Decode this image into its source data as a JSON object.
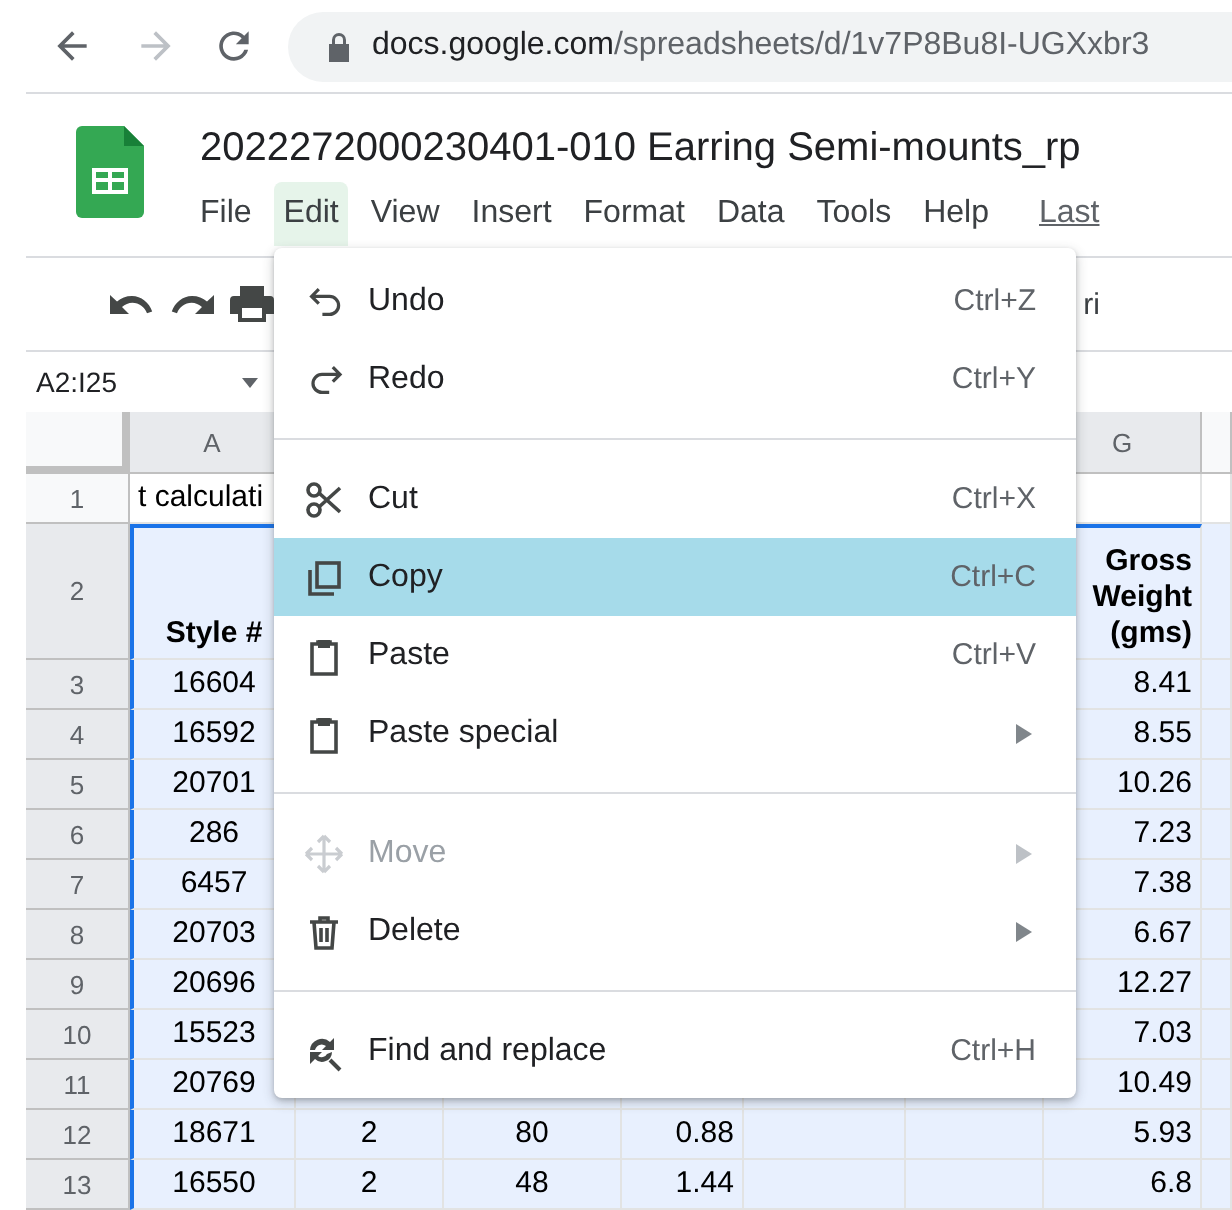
{
  "browser": {
    "url_host": "docs.google.com",
    "url_path": "/spreadsheets/d/1v7P8Bu8I-UGXxbr3"
  },
  "document": {
    "title": "2022272000230401-010 Earring Semi-mounts_rp"
  },
  "menubar": [
    {
      "label": "File",
      "selected": false
    },
    {
      "label": "Edit",
      "selected": true
    },
    {
      "label": "View",
      "selected": false
    },
    {
      "label": "Insert",
      "selected": false
    },
    {
      "label": "Format",
      "selected": false
    },
    {
      "label": "Data",
      "selected": false
    },
    {
      "label": "Tools",
      "selected": false
    },
    {
      "label": "Help",
      "selected": false
    }
  ],
  "last_edit_link": "Last",
  "toolbar": {
    "font_text": "ri"
  },
  "name_box": "A2:I25",
  "grid": {
    "columns": [
      {
        "label": "A",
        "selected": true
      },
      {
        "label": "G",
        "selected": true
      }
    ],
    "rows": [
      {
        "number": "1",
        "selected": false,
        "bold": false,
        "cells": {
          "A": "t calculati"
        }
      },
      {
        "number": "2",
        "selected": true,
        "bold": true,
        "cells": {
          "A": "Style #",
          "G": "Gross Weight (gms)"
        }
      },
      {
        "number": "3",
        "selected": true,
        "bold": false,
        "cells": {
          "A": "16604",
          "G": "8.41"
        }
      },
      {
        "number": "4",
        "selected": true,
        "bold": false,
        "cells": {
          "A": "16592",
          "G": "8.55"
        }
      },
      {
        "number": "5",
        "selected": true,
        "bold": false,
        "cells": {
          "A": "20701",
          "G": "10.26"
        }
      },
      {
        "number": "6",
        "selected": true,
        "bold": false,
        "cells": {
          "A": "286",
          "G": "7.23"
        }
      },
      {
        "number": "7",
        "selected": true,
        "bold": false,
        "cells": {
          "A": "6457",
          "G": "7.38"
        }
      },
      {
        "number": "8",
        "selected": true,
        "bold": false,
        "cells": {
          "A": "20703",
          "G": "6.67"
        }
      },
      {
        "number": "9",
        "selected": true,
        "bold": false,
        "cells": {
          "A": "20696",
          "G": "12.27"
        }
      },
      {
        "number": "10",
        "selected": true,
        "bold": false,
        "cells": {
          "A": "15523",
          "G": "7.03"
        }
      },
      {
        "number": "11",
        "selected": true,
        "bold": false,
        "cells": {
          "A": "20769",
          "G": "10.49"
        }
      },
      {
        "number": "12",
        "selected": true,
        "bold": false,
        "cells": {
          "A": "18671",
          "B": "2",
          "C": "80",
          "D": "0.88",
          "G": "5.93"
        }
      },
      {
        "number": "13",
        "selected": true,
        "bold": false,
        "cells": {
          "A": "16550",
          "B": "2",
          "C": "48",
          "D": "1.44",
          "G": "6.8"
        }
      }
    ]
  },
  "edit_menu": [
    {
      "kind": "item",
      "label": "Undo",
      "shortcut": "Ctrl+Z",
      "submenu": false,
      "disabled": false,
      "selected": false
    },
    {
      "kind": "item",
      "label": "Redo",
      "shortcut": "Ctrl+Y",
      "submenu": false,
      "disabled": false,
      "selected": false
    },
    {
      "kind": "divider"
    },
    {
      "kind": "item",
      "label": "Cut",
      "shortcut": "Ctrl+X",
      "submenu": false,
      "disabled": false,
      "selected": false
    },
    {
      "kind": "item",
      "label": "Copy",
      "shortcut": "Ctrl+C",
      "submenu": false,
      "disabled": false,
      "selected": true
    },
    {
      "kind": "item",
      "label": "Paste",
      "shortcut": "Ctrl+V",
      "submenu": false,
      "disabled": false,
      "selected": false
    },
    {
      "kind": "item",
      "label": "Paste special",
      "submenu": true,
      "disabled": false,
      "selected": false
    },
    {
      "kind": "divider"
    },
    {
      "kind": "item",
      "label": "Move",
      "submenu": true,
      "disabled": true,
      "selected": false
    },
    {
      "kind": "item",
      "label": "Delete",
      "submenu": true,
      "disabled": false,
      "selected": false
    },
    {
      "kind": "divider"
    },
    {
      "kind": "item",
      "label": "Find and replace",
      "shortcut": "Ctrl+H",
      "submenu": false,
      "disabled": false,
      "selected": false
    }
  ]
}
